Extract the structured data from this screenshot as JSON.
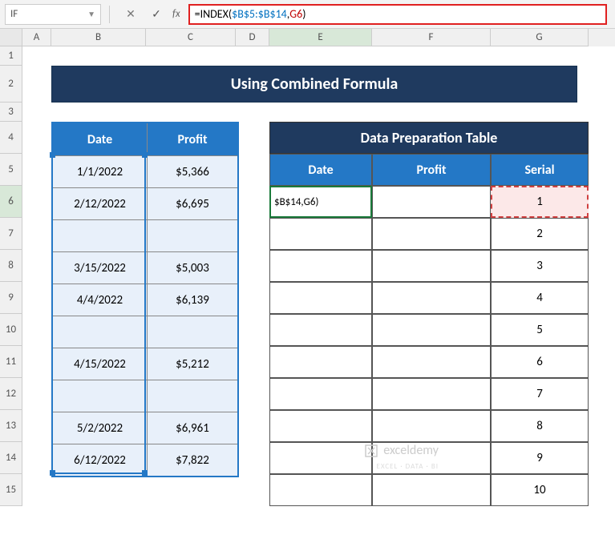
{
  "name_box": "IF",
  "formula": {
    "prefix": "=",
    "fn": "INDEX",
    "open": "(",
    "ref1": "$B$5:$B$14",
    "comma": ",",
    "ref2": "G6",
    "close": ")"
  },
  "columns": [
    "A",
    "B",
    "C",
    "D",
    "E",
    "F",
    "G"
  ],
  "rows": [
    "1",
    "2",
    "3",
    "4",
    "5",
    "6",
    "7",
    "8",
    "9",
    "10",
    "11",
    "12",
    "13",
    "14",
    "15"
  ],
  "title": "Using Combined Formula",
  "table1": {
    "headers": {
      "date": "Date",
      "profit": "Profit"
    },
    "rows": [
      {
        "date": "1/1/2022",
        "profit": "$5,366"
      },
      {
        "date": "2/12/2022",
        "profit": "$6,695"
      },
      {
        "date": "",
        "profit": ""
      },
      {
        "date": "3/15/2022",
        "profit": "$5,003"
      },
      {
        "date": "4/4/2022",
        "profit": "$6,139"
      },
      {
        "date": "",
        "profit": ""
      },
      {
        "date": "4/15/2022",
        "profit": "$5,212"
      },
      {
        "date": "",
        "profit": ""
      },
      {
        "date": "5/2/2022",
        "profit": "$6,961"
      },
      {
        "date": "6/12/2022",
        "profit": "$7,822"
      }
    ]
  },
  "table2": {
    "title": "Data Preparation Table",
    "headers": {
      "date": "Date",
      "profit": "Profit",
      "serial": "Serial"
    },
    "cell_e6": "$B$14,G6)",
    "serials": [
      "1",
      "2",
      "3",
      "4",
      "5",
      "6",
      "7",
      "8",
      "9",
      "10"
    ]
  },
  "watermark": "exceldemy",
  "watermark_sub": "EXCEL · DATA · BI"
}
